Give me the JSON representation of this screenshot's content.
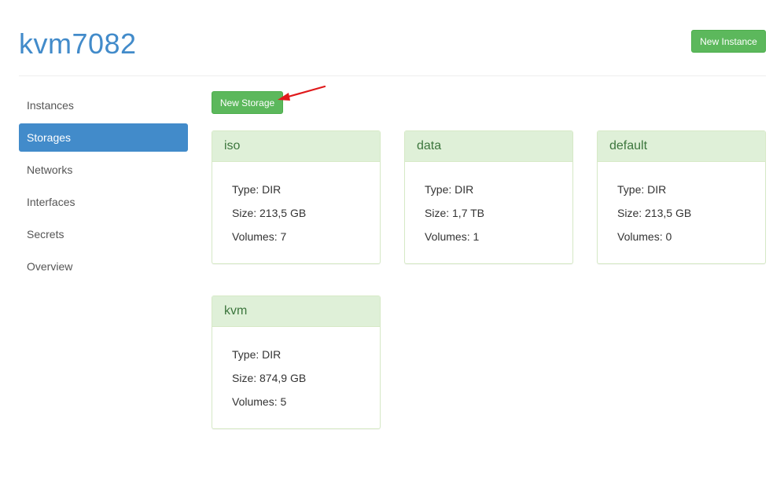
{
  "header": {
    "title": "kvm7082",
    "new_instance_label": "New Instance"
  },
  "sidebar": {
    "items": [
      {
        "label": "Instances"
      },
      {
        "label": "Storages",
        "active": true
      },
      {
        "label": "Networks"
      },
      {
        "label": "Interfaces"
      },
      {
        "label": "Secrets"
      },
      {
        "label": "Overview"
      }
    ]
  },
  "content": {
    "new_storage_label": "New Storage",
    "storages": [
      {
        "name": "iso",
        "type": "Type: DIR",
        "size": "Size: 213,5 GB",
        "volumes": "Volumes: 7"
      },
      {
        "name": "data",
        "type": "Type: DIR",
        "size": "Size: 1,7 TB",
        "volumes": "Volumes: 1"
      },
      {
        "name": "default",
        "type": "Type: DIR",
        "size": "Size: 213,5 GB",
        "volumes": "Volumes: 0"
      },
      {
        "name": "kvm",
        "type": "Type: DIR",
        "size": "Size: 874,9 GB",
        "volumes": "Volumes: 5"
      }
    ]
  },
  "colors": {
    "primary": "#428bca",
    "success": "#5cb85c",
    "panel_header": "#dff0d8",
    "panel_header_text": "#3c763d",
    "annotation_arrow": "#e0191b"
  }
}
